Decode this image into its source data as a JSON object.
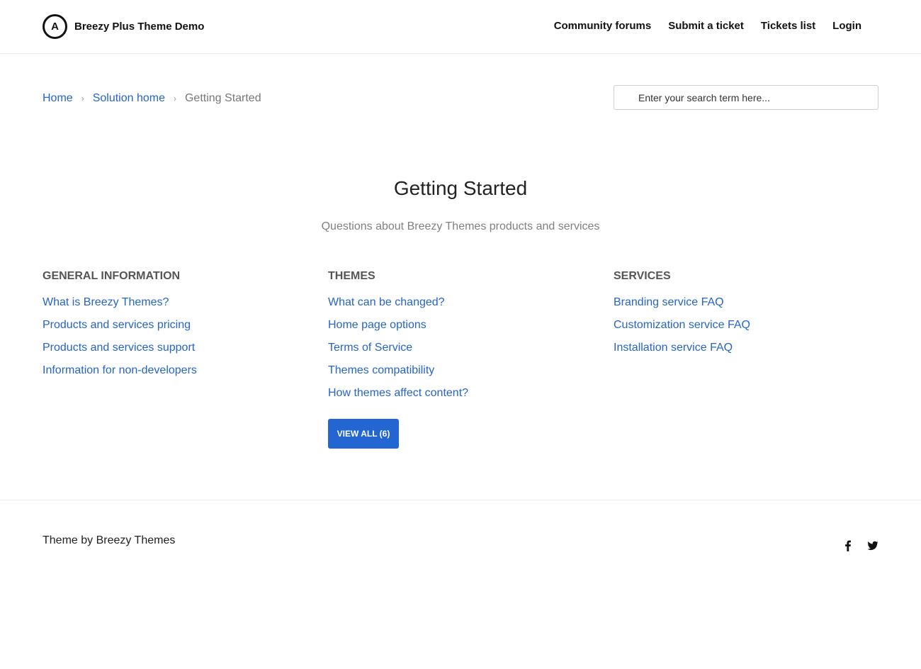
{
  "header": {
    "logo_letter": "A",
    "brand": "Breezy Plus Theme Demo",
    "nav": [
      {
        "label": "Community forums"
      },
      {
        "label": "Submit a ticket"
      },
      {
        "label": "Tickets list"
      },
      {
        "label": "Login"
      }
    ]
  },
  "breadcrumb": {
    "home": "Home",
    "solution_home": "Solution home",
    "current": "Getting Started",
    "separator": "›"
  },
  "search": {
    "placeholder": "Enter your search term here..."
  },
  "main": {
    "title": "Getting Started",
    "subtitle": "Questions about Breezy Themes products and services",
    "sections": [
      {
        "heading": "GENERAL INFORMATION",
        "links": [
          "What is Breezy Themes?",
          "Products and services pricing",
          "Products and services support",
          "Information for non-developers"
        ]
      },
      {
        "heading": "THEMES",
        "links": [
          "What can be changed?",
          "Home page options",
          "Terms of Service",
          "Themes compatibility",
          "How themes affect content?"
        ],
        "view_all": "VIEW ALL (6)"
      },
      {
        "heading": "SERVICES",
        "links": [
          "Branding service FAQ",
          "Customization service FAQ",
          "Installation service FAQ"
        ]
      }
    ]
  },
  "footer": {
    "text": "Theme by Breezy Themes",
    "social": [
      "facebook-icon",
      "twitter-icon"
    ]
  },
  "colors": {
    "link": "#2564c8",
    "button": "#2366d1",
    "heading": "#555555",
    "muted": "#808080"
  }
}
